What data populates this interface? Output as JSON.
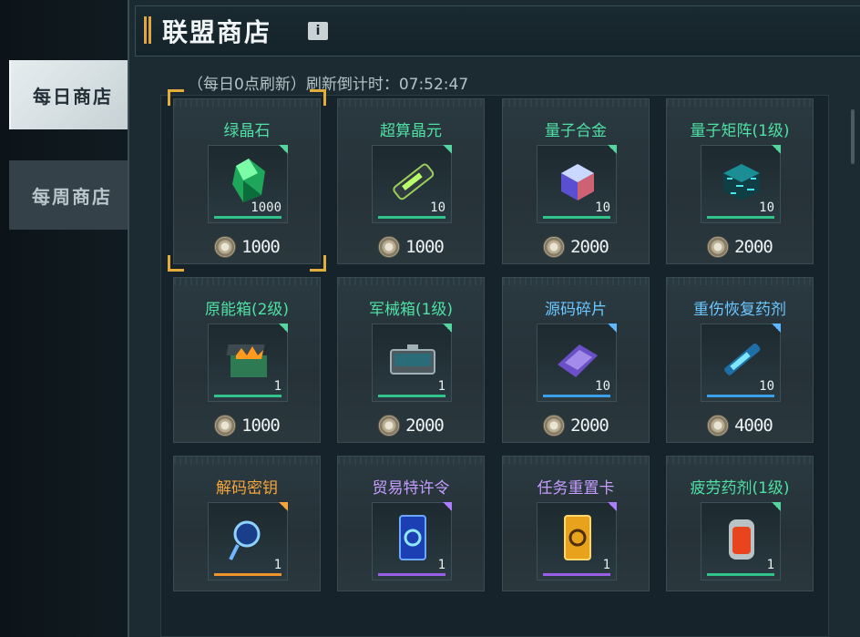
{
  "header": {
    "title": "联盟商店",
    "info_label": "i"
  },
  "tabs": [
    {
      "label": "每日商店",
      "active": true
    },
    {
      "label": "每周商店",
      "active": false
    }
  ],
  "refresh": {
    "text": "（每日0点刷新）刷新倒计时：07:52:47"
  },
  "background_code": "11001",
  "items": [
    {
      "name": "绿晶石",
      "qty": "1000",
      "price": "1000",
      "rarity": "green",
      "icon": "green-crystal-icon"
    },
    {
      "name": "超算晶元",
      "qty": "10",
      "price": "1000",
      "rarity": "green",
      "icon": "wafer-icon"
    },
    {
      "name": "量子合金",
      "qty": "10",
      "price": "2000",
      "rarity": "green",
      "icon": "alloy-cube-icon"
    },
    {
      "name": "量子矩阵(1级)",
      "qty": "10",
      "price": "2000",
      "rarity": "green",
      "icon": "matrix-cube-icon"
    },
    {
      "name": "原能箱(2级)",
      "qty": "1",
      "price": "1000",
      "rarity": "green",
      "icon": "energy-chest-icon"
    },
    {
      "name": "军械箱(1级)",
      "qty": "1",
      "price": "2000",
      "rarity": "green",
      "icon": "armory-case-icon"
    },
    {
      "name": "源码碎片",
      "qty": "10",
      "price": "2000",
      "rarity": "blue",
      "icon": "code-shard-icon"
    },
    {
      "name": "重伤恢复药剂",
      "qty": "10",
      "price": "4000",
      "rarity": "blue",
      "icon": "recovery-syringe-icon"
    },
    {
      "name": "解码密钥",
      "qty": "1",
      "price": "",
      "rarity": "orange",
      "icon": "decode-key-icon"
    },
    {
      "name": "贸易特许令",
      "qty": "1",
      "price": "",
      "rarity": "purple",
      "icon": "trade-permit-icon"
    },
    {
      "name": "任务重置卡",
      "qty": "1",
      "price": "",
      "rarity": "purple",
      "icon": "reset-card-icon"
    },
    {
      "name": "疲劳药剂(1级)",
      "qty": "1",
      "price": "",
      "rarity": "green",
      "icon": "fatigue-potion-icon"
    }
  ],
  "colors": {
    "accent": "#e3ad3c",
    "green": "#4fe0a4",
    "blue": "#6cc7ff",
    "orange": "#f4a53c",
    "purple": "#c79dff"
  }
}
